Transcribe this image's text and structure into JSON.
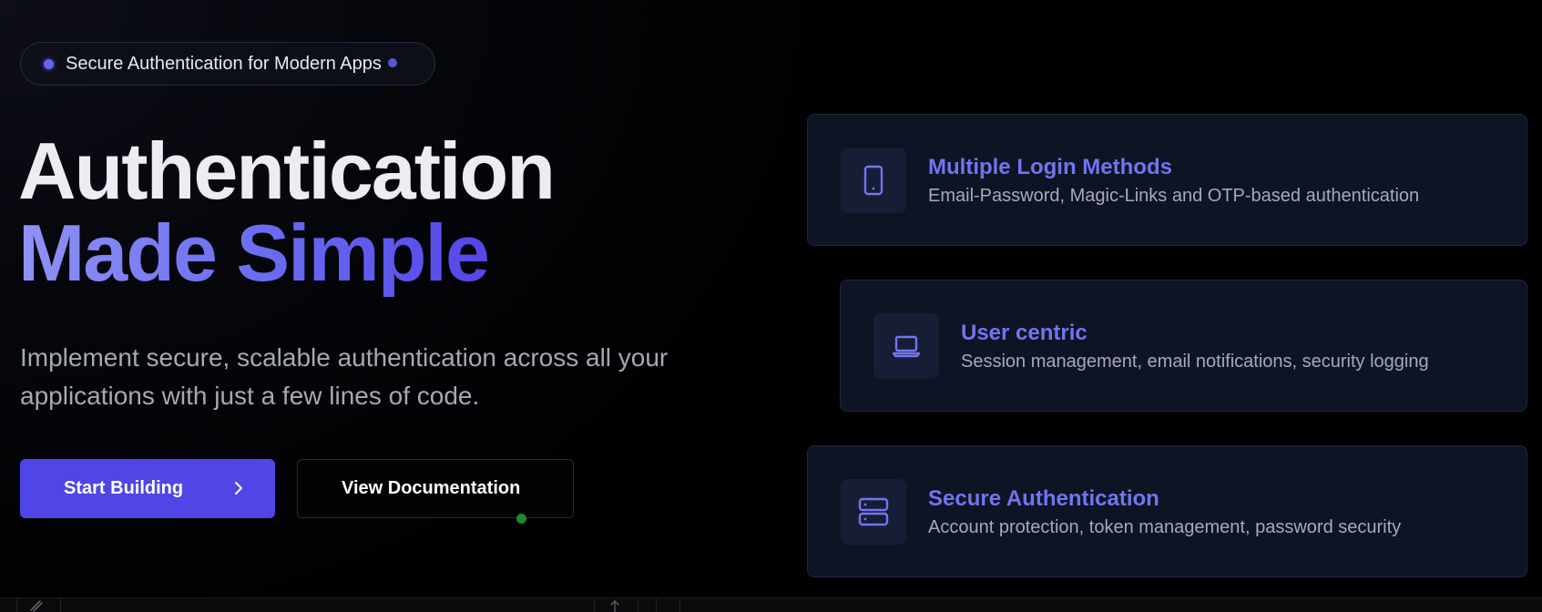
{
  "badge": {
    "label": "Secure Authentication for Modern Apps"
  },
  "hero": {
    "headline_line1": "Authentication",
    "headline_line2": "Made Simple",
    "subtitle": "Implement secure, scalable authentication across all your applications with just a few lines of code."
  },
  "actions": {
    "primary_label": "Start Building",
    "primary_icon": "chevron-right-icon",
    "secondary_label": "View Documentation"
  },
  "features": [
    {
      "title": "Multiple Login Methods",
      "description": "Email-Password, Magic-Links and OTP-based authentication",
      "icon": "smartphone-icon"
    },
    {
      "title": "User centric",
      "description": "Session management, email notifications, security logging",
      "icon": "laptop-icon"
    },
    {
      "title": "Secure Authentication",
      "description": "Account protection, token management, password security",
      "icon": "server-icon"
    }
  ],
  "colors": {
    "accent": "#4f46e5",
    "accent_light": "#6366f1",
    "background": "#020203",
    "card_background": "#0f1424",
    "title_text": "#ececf3"
  }
}
